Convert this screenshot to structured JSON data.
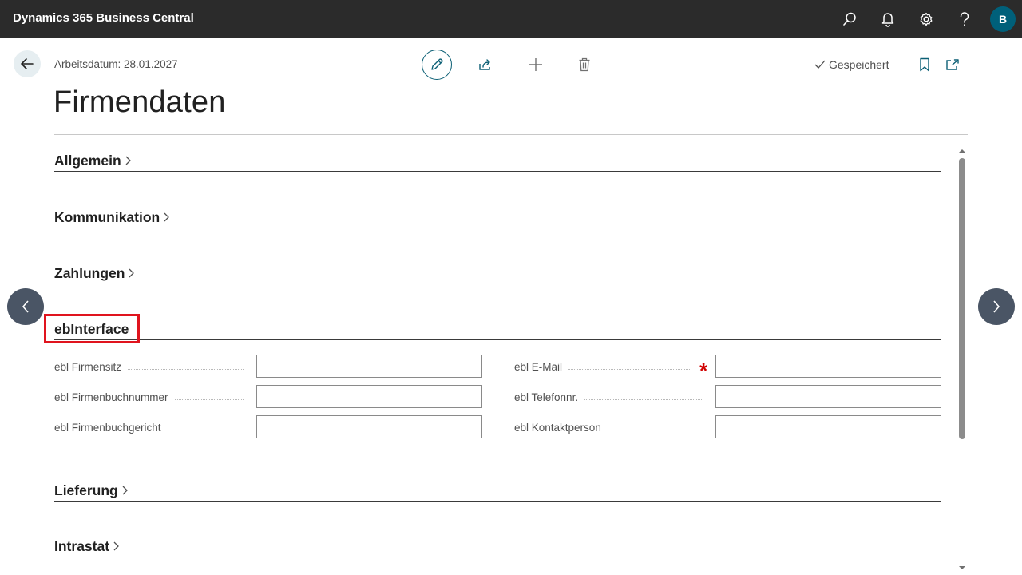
{
  "app": {
    "title": "Dynamics 365 Business Central",
    "user_initial": "B"
  },
  "header": {
    "workdate": "Arbeitsdatum: 28.01.2027",
    "saved_status": "Gespeichert",
    "page_title": "Firmendaten"
  },
  "sections": {
    "allgemein": "Allgemein",
    "kommunikation": "Kommunikation",
    "zahlungen": "Zahlungen",
    "ebinterface": "ebInterface",
    "lieferung": "Lieferung",
    "intrastat": "Intrastat"
  },
  "ebinterface_fields": {
    "firmensitz": {
      "label": "ebl Firmensitz",
      "value": ""
    },
    "firmenbuchnummer": {
      "label": "ebl Firmenbuchnummer",
      "value": ""
    },
    "firmenbuchgericht": {
      "label": "ebl Firmenbuchgericht",
      "value": ""
    },
    "email": {
      "label": "ebl E-Mail",
      "value": "",
      "required_mark": "*"
    },
    "telefonnr": {
      "label": "ebl Telefonnr.",
      "value": ""
    },
    "kontaktperson": {
      "label": "ebl Kontaktperson",
      "value": ""
    }
  },
  "icons": {
    "search": "search-icon",
    "bell": "bell-icon",
    "gear": "gear-icon",
    "help": "help-icon",
    "back": "back-arrow-icon",
    "edit": "pencil-icon",
    "share": "share-icon",
    "add": "plus-icon",
    "delete": "trash-icon",
    "saved": "checkmark-icon",
    "bookmark": "bookmark-icon",
    "open_new": "open-in-new-window-icon"
  },
  "colors": {
    "topbar": "#2b2b2b",
    "accent": "#0b5f75",
    "highlight": "#e0141e",
    "required": "#d00000",
    "avatar": "#00607a"
  }
}
